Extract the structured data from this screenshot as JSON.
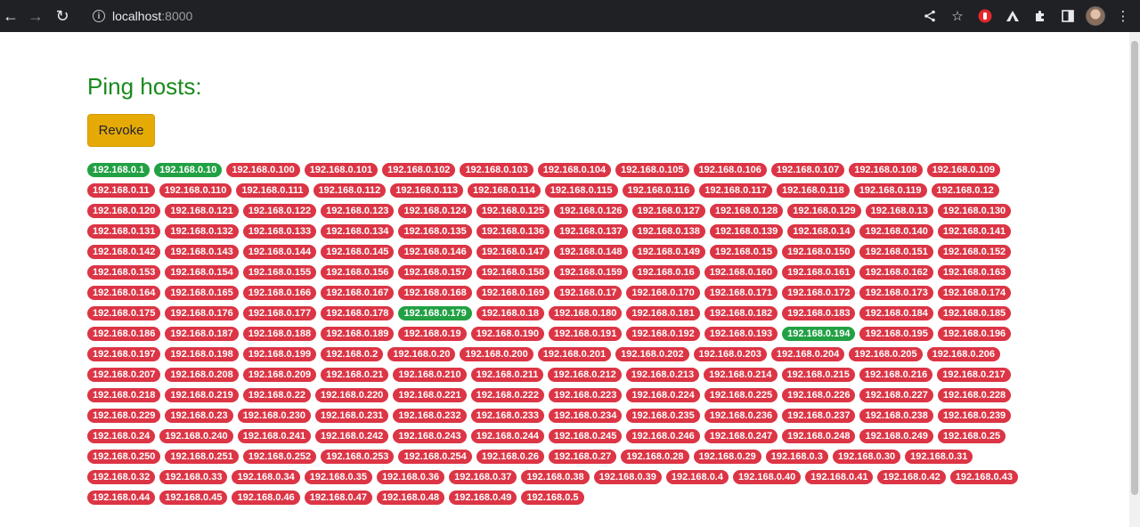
{
  "browser": {
    "url_host": "localhost",
    "url_port": ":8000"
  },
  "page": {
    "title": "Ping hosts:",
    "revoke_label": "Revoke"
  },
  "colors": {
    "title": "#198a1d",
    "button": "#e6aa07",
    "badge_up": "#22a144",
    "badge_down": "#dc3545"
  },
  "hosts": [
    {
      "ip": "192.168.0.1",
      "up": true
    },
    {
      "ip": "192.168.0.10",
      "up": true
    },
    {
      "ip": "192.168.0.100",
      "up": false
    },
    {
      "ip": "192.168.0.101",
      "up": false
    },
    {
      "ip": "192.168.0.102",
      "up": false
    },
    {
      "ip": "192.168.0.103",
      "up": false
    },
    {
      "ip": "192.168.0.104",
      "up": false
    },
    {
      "ip": "192.168.0.105",
      "up": false
    },
    {
      "ip": "192.168.0.106",
      "up": false
    },
    {
      "ip": "192.168.0.107",
      "up": false
    },
    {
      "ip": "192.168.0.108",
      "up": false
    },
    {
      "ip": "192.168.0.109",
      "up": false
    },
    {
      "ip": "192.168.0.11",
      "up": false
    },
    {
      "ip": "192.168.0.110",
      "up": false
    },
    {
      "ip": "192.168.0.111",
      "up": false
    },
    {
      "ip": "192.168.0.112",
      "up": false
    },
    {
      "ip": "192.168.0.113",
      "up": false
    },
    {
      "ip": "192.168.0.114",
      "up": false
    },
    {
      "ip": "192.168.0.115",
      "up": false
    },
    {
      "ip": "192.168.0.116",
      "up": false
    },
    {
      "ip": "192.168.0.117",
      "up": false
    },
    {
      "ip": "192.168.0.118",
      "up": false
    },
    {
      "ip": "192.168.0.119",
      "up": false
    },
    {
      "ip": "192.168.0.12",
      "up": false
    },
    {
      "ip": "192.168.0.120",
      "up": false
    },
    {
      "ip": "192.168.0.121",
      "up": false
    },
    {
      "ip": "192.168.0.122",
      "up": false
    },
    {
      "ip": "192.168.0.123",
      "up": false
    },
    {
      "ip": "192.168.0.124",
      "up": false
    },
    {
      "ip": "192.168.0.125",
      "up": false
    },
    {
      "ip": "192.168.0.126",
      "up": false
    },
    {
      "ip": "192.168.0.127",
      "up": false
    },
    {
      "ip": "192.168.0.128",
      "up": false
    },
    {
      "ip": "192.168.0.129",
      "up": false
    },
    {
      "ip": "192.168.0.13",
      "up": false
    },
    {
      "ip": "192.168.0.130",
      "up": false
    },
    {
      "ip": "192.168.0.131",
      "up": false
    },
    {
      "ip": "192.168.0.132",
      "up": false
    },
    {
      "ip": "192.168.0.133",
      "up": false
    },
    {
      "ip": "192.168.0.134",
      "up": false
    },
    {
      "ip": "192.168.0.135",
      "up": false
    },
    {
      "ip": "192.168.0.136",
      "up": false
    },
    {
      "ip": "192.168.0.137",
      "up": false
    },
    {
      "ip": "192.168.0.138",
      "up": false
    },
    {
      "ip": "192.168.0.139",
      "up": false
    },
    {
      "ip": "192.168.0.14",
      "up": false
    },
    {
      "ip": "192.168.0.140",
      "up": false
    },
    {
      "ip": "192.168.0.141",
      "up": false
    },
    {
      "ip": "192.168.0.142",
      "up": false
    },
    {
      "ip": "192.168.0.143",
      "up": false
    },
    {
      "ip": "192.168.0.144",
      "up": false
    },
    {
      "ip": "192.168.0.145",
      "up": false
    },
    {
      "ip": "192.168.0.146",
      "up": false
    },
    {
      "ip": "192.168.0.147",
      "up": false
    },
    {
      "ip": "192.168.0.148",
      "up": false
    },
    {
      "ip": "192.168.0.149",
      "up": false
    },
    {
      "ip": "192.168.0.15",
      "up": false
    },
    {
      "ip": "192.168.0.150",
      "up": false
    },
    {
      "ip": "192.168.0.151",
      "up": false
    },
    {
      "ip": "192.168.0.152",
      "up": false
    },
    {
      "ip": "192.168.0.153",
      "up": false
    },
    {
      "ip": "192.168.0.154",
      "up": false
    },
    {
      "ip": "192.168.0.155",
      "up": false
    },
    {
      "ip": "192.168.0.156",
      "up": false
    },
    {
      "ip": "192.168.0.157",
      "up": false
    },
    {
      "ip": "192.168.0.158",
      "up": false
    },
    {
      "ip": "192.168.0.159",
      "up": false
    },
    {
      "ip": "192.168.0.16",
      "up": false
    },
    {
      "ip": "192.168.0.160",
      "up": false
    },
    {
      "ip": "192.168.0.161",
      "up": false
    },
    {
      "ip": "192.168.0.162",
      "up": false
    },
    {
      "ip": "192.168.0.163",
      "up": false
    },
    {
      "ip": "192.168.0.164",
      "up": false
    },
    {
      "ip": "192.168.0.165",
      "up": false
    },
    {
      "ip": "192.168.0.166",
      "up": false
    },
    {
      "ip": "192.168.0.167",
      "up": false
    },
    {
      "ip": "192.168.0.168",
      "up": false
    },
    {
      "ip": "192.168.0.169",
      "up": false
    },
    {
      "ip": "192.168.0.17",
      "up": false
    },
    {
      "ip": "192.168.0.170",
      "up": false
    },
    {
      "ip": "192.168.0.171",
      "up": false
    },
    {
      "ip": "192.168.0.172",
      "up": false
    },
    {
      "ip": "192.168.0.173",
      "up": false
    },
    {
      "ip": "192.168.0.174",
      "up": false
    },
    {
      "ip": "192.168.0.175",
      "up": false
    },
    {
      "ip": "192.168.0.176",
      "up": false
    },
    {
      "ip": "192.168.0.177",
      "up": false
    },
    {
      "ip": "192.168.0.178",
      "up": false
    },
    {
      "ip": "192.168.0.179",
      "up": true
    },
    {
      "ip": "192.168.0.18",
      "up": false
    },
    {
      "ip": "192.168.0.180",
      "up": false
    },
    {
      "ip": "192.168.0.181",
      "up": false
    },
    {
      "ip": "192.168.0.182",
      "up": false
    },
    {
      "ip": "192.168.0.183",
      "up": false
    },
    {
      "ip": "192.168.0.184",
      "up": false
    },
    {
      "ip": "192.168.0.185",
      "up": false
    },
    {
      "ip": "192.168.0.186",
      "up": false
    },
    {
      "ip": "192.168.0.187",
      "up": false
    },
    {
      "ip": "192.168.0.188",
      "up": false
    },
    {
      "ip": "192.168.0.189",
      "up": false
    },
    {
      "ip": "192.168.0.19",
      "up": false
    },
    {
      "ip": "192.168.0.190",
      "up": false
    },
    {
      "ip": "192.168.0.191",
      "up": false
    },
    {
      "ip": "192.168.0.192",
      "up": false
    },
    {
      "ip": "192.168.0.193",
      "up": false
    },
    {
      "ip": "192.168.0.194",
      "up": true
    },
    {
      "ip": "192.168.0.195",
      "up": false
    },
    {
      "ip": "192.168.0.196",
      "up": false
    },
    {
      "ip": "192.168.0.197",
      "up": false
    },
    {
      "ip": "192.168.0.198",
      "up": false
    },
    {
      "ip": "192.168.0.199",
      "up": false
    },
    {
      "ip": "192.168.0.2",
      "up": false
    },
    {
      "ip": "192.168.0.20",
      "up": false
    },
    {
      "ip": "192.168.0.200",
      "up": false
    },
    {
      "ip": "192.168.0.201",
      "up": false
    },
    {
      "ip": "192.168.0.202",
      "up": false
    },
    {
      "ip": "192.168.0.203",
      "up": false
    },
    {
      "ip": "192.168.0.204",
      "up": false
    },
    {
      "ip": "192.168.0.205",
      "up": false
    },
    {
      "ip": "192.168.0.206",
      "up": false
    },
    {
      "ip": "192.168.0.207",
      "up": false
    },
    {
      "ip": "192.168.0.208",
      "up": false
    },
    {
      "ip": "192.168.0.209",
      "up": false
    },
    {
      "ip": "192.168.0.21",
      "up": false
    },
    {
      "ip": "192.168.0.210",
      "up": false
    },
    {
      "ip": "192.168.0.211",
      "up": false
    },
    {
      "ip": "192.168.0.212",
      "up": false
    },
    {
      "ip": "192.168.0.213",
      "up": false
    },
    {
      "ip": "192.168.0.214",
      "up": false
    },
    {
      "ip": "192.168.0.215",
      "up": false
    },
    {
      "ip": "192.168.0.216",
      "up": false
    },
    {
      "ip": "192.168.0.217",
      "up": false
    },
    {
      "ip": "192.168.0.218",
      "up": false
    },
    {
      "ip": "192.168.0.219",
      "up": false
    },
    {
      "ip": "192.168.0.22",
      "up": false
    },
    {
      "ip": "192.168.0.220",
      "up": false
    },
    {
      "ip": "192.168.0.221",
      "up": false
    },
    {
      "ip": "192.168.0.222",
      "up": false
    },
    {
      "ip": "192.168.0.223",
      "up": false
    },
    {
      "ip": "192.168.0.224",
      "up": false
    },
    {
      "ip": "192.168.0.225",
      "up": false
    },
    {
      "ip": "192.168.0.226",
      "up": false
    },
    {
      "ip": "192.168.0.227",
      "up": false
    },
    {
      "ip": "192.168.0.228",
      "up": false
    },
    {
      "ip": "192.168.0.229",
      "up": false
    },
    {
      "ip": "192.168.0.23",
      "up": false
    },
    {
      "ip": "192.168.0.230",
      "up": false
    },
    {
      "ip": "192.168.0.231",
      "up": false
    },
    {
      "ip": "192.168.0.232",
      "up": false
    },
    {
      "ip": "192.168.0.233",
      "up": false
    },
    {
      "ip": "192.168.0.234",
      "up": false
    },
    {
      "ip": "192.168.0.235",
      "up": false
    },
    {
      "ip": "192.168.0.236",
      "up": false
    },
    {
      "ip": "192.168.0.237",
      "up": false
    },
    {
      "ip": "192.168.0.238",
      "up": false
    },
    {
      "ip": "192.168.0.239",
      "up": false
    },
    {
      "ip": "192.168.0.24",
      "up": false
    },
    {
      "ip": "192.168.0.240",
      "up": false
    },
    {
      "ip": "192.168.0.241",
      "up": false
    },
    {
      "ip": "192.168.0.242",
      "up": false
    },
    {
      "ip": "192.168.0.243",
      "up": false
    },
    {
      "ip": "192.168.0.244",
      "up": false
    },
    {
      "ip": "192.168.0.245",
      "up": false
    },
    {
      "ip": "192.168.0.246",
      "up": false
    },
    {
      "ip": "192.168.0.247",
      "up": false
    },
    {
      "ip": "192.168.0.248",
      "up": false
    },
    {
      "ip": "192.168.0.249",
      "up": false
    },
    {
      "ip": "192.168.0.25",
      "up": false
    },
    {
      "ip": "192.168.0.250",
      "up": false
    },
    {
      "ip": "192.168.0.251",
      "up": false
    },
    {
      "ip": "192.168.0.252",
      "up": false
    },
    {
      "ip": "192.168.0.253",
      "up": false
    },
    {
      "ip": "192.168.0.254",
      "up": false
    },
    {
      "ip": "192.168.0.26",
      "up": false
    },
    {
      "ip": "192.168.0.27",
      "up": false
    },
    {
      "ip": "192.168.0.28",
      "up": false
    },
    {
      "ip": "192.168.0.29",
      "up": false
    },
    {
      "ip": "192.168.0.3",
      "up": false
    },
    {
      "ip": "192.168.0.30",
      "up": false
    },
    {
      "ip": "192.168.0.31",
      "up": false
    },
    {
      "ip": "192.168.0.32",
      "up": false
    },
    {
      "ip": "192.168.0.33",
      "up": false
    },
    {
      "ip": "192.168.0.34",
      "up": false
    },
    {
      "ip": "192.168.0.35",
      "up": false
    },
    {
      "ip": "192.168.0.36",
      "up": false
    },
    {
      "ip": "192.168.0.37",
      "up": false
    },
    {
      "ip": "192.168.0.38",
      "up": false
    },
    {
      "ip": "192.168.0.39",
      "up": false
    },
    {
      "ip": "192.168.0.4",
      "up": false
    },
    {
      "ip": "192.168.0.40",
      "up": false
    },
    {
      "ip": "192.168.0.41",
      "up": false
    },
    {
      "ip": "192.168.0.42",
      "up": false
    },
    {
      "ip": "192.168.0.43",
      "up": false
    },
    {
      "ip": "192.168.0.44",
      "up": false
    },
    {
      "ip": "192.168.0.45",
      "up": false
    },
    {
      "ip": "192.168.0.46",
      "up": false
    },
    {
      "ip": "192.168.0.47",
      "up": false
    },
    {
      "ip": "192.168.0.48",
      "up": false
    },
    {
      "ip": "192.168.0.49",
      "up": false
    },
    {
      "ip": "192.168.0.5",
      "up": false
    }
  ]
}
